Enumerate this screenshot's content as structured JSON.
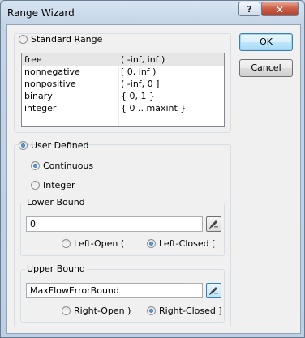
{
  "window": {
    "title": "Range Wizard",
    "help_label": "?",
    "close_label": "✕"
  },
  "buttons": {
    "ok_label": "OK",
    "cancel_label": "Cancel"
  },
  "standard": {
    "label": "Standard Range",
    "items": [
      {
        "name": "free",
        "range": "( -inf, inf )"
      },
      {
        "name": "nonnegative",
        "range": "[ 0, inf )"
      },
      {
        "name": "nonpositive",
        "range": "( -inf, 0 ]"
      },
      {
        "name": "binary",
        "range": "{ 0, 1 }"
      },
      {
        "name": "integer",
        "range": "{ 0 .. maxint }"
      }
    ]
  },
  "user_defined": {
    "label": "User Defined",
    "continuous_label": "Continuous",
    "integer_label": "Integer"
  },
  "lower_bound": {
    "label": "Lower Bound",
    "value": "0",
    "open_label": "Left-Open (",
    "closed_label": "Left-Closed ["
  },
  "upper_bound": {
    "label": "Upper Bound",
    "value": "MaxFlowErrorBound",
    "open_label": "Right-Open )",
    "closed_label": "Right-Closed ]"
  },
  "icons": {
    "edit_bound": "pencil-edit-icon"
  }
}
